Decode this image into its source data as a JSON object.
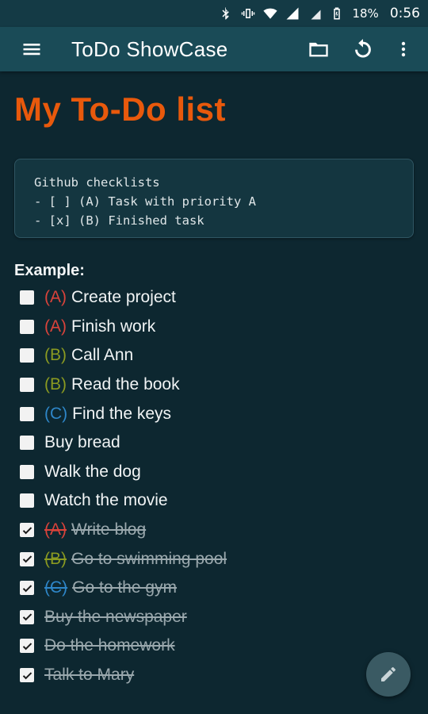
{
  "statusbar": {
    "battery": "18%",
    "time": "0:56"
  },
  "appbar": {
    "title": "ToDo ShowCase"
  },
  "page": {
    "title": "My To-Do list",
    "code_lines": "Github checklists\n- [ ] (A) Task with priority A\n- [x] (B) Finished task",
    "example_label": "Example:"
  },
  "tasks": [
    {
      "priority": "(A)",
      "text": "Create project",
      "done": false
    },
    {
      "priority": "(A)",
      "text": "Finish work",
      "done": false
    },
    {
      "priority": "(B)",
      "text": "Call Ann",
      "done": false
    },
    {
      "priority": "(B)",
      "text": "Read the book",
      "done": false
    },
    {
      "priority": "(C)",
      "text": "Find the keys",
      "done": false
    },
    {
      "priority": "",
      "text": "Buy bread",
      "done": false
    },
    {
      "priority": "",
      "text": "Walk the dog",
      "done": false
    },
    {
      "priority": "",
      "text": "Watch the movie",
      "done": false
    },
    {
      "priority": "(A)",
      "text": "Write blog",
      "done": true
    },
    {
      "priority": "(B)",
      "text": "Go to swimming pool",
      "done": true
    },
    {
      "priority": "(C)",
      "text": "Go to the gym",
      "done": true
    },
    {
      "priority": "",
      "text": "Buy the newspaper",
      "done": true
    },
    {
      "priority": "",
      "text": "Do the homework",
      "done": true
    },
    {
      "priority": "",
      "text": "Talk to Mary",
      "done": true
    }
  ],
  "colors": {
    "background": "#0d2730",
    "appbar": "#1a4b57",
    "title_accent": "#e8590c",
    "priority_a": "#d9433b",
    "priority_b": "#8a9a21",
    "priority_c": "#2e86c8"
  }
}
